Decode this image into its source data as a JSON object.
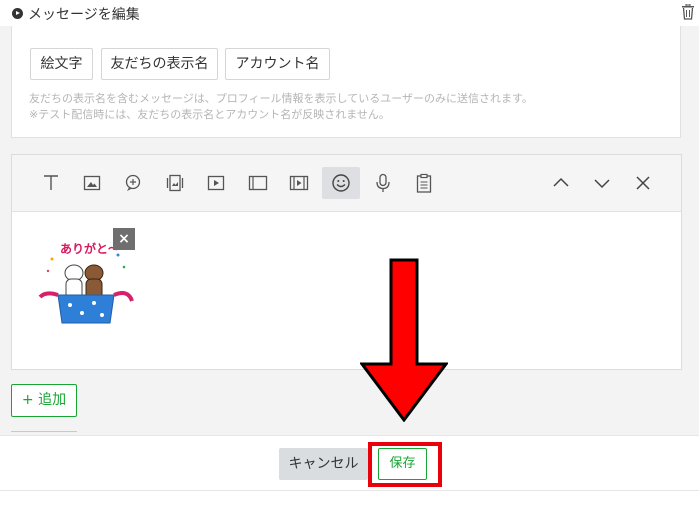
{
  "header": {
    "title": "メッセージを編集",
    "play_icon": "play-circle-icon",
    "delete_icon": "trash-icon"
  },
  "variables": {
    "chips": [
      "絵文字",
      "友だちの表示名",
      "アカウント名"
    ],
    "note_line1": "友だちの表示名を含むメッセージは、プロフィール情報を表示しているユーザーのみに送信されます。",
    "note_line2": "※テスト配信時には、友だちの表示名とアカウント名が反映されません。"
  },
  "editor": {
    "toolbar_icons": [
      "text-icon",
      "image-icon",
      "chat-bubble-icon",
      "card-icon",
      "video-icon",
      "rich-message-icon",
      "rich-video-icon",
      "sticker-icon",
      "mic-icon",
      "clipboard-icon"
    ],
    "active_tool": "sticker-icon",
    "nav_icons": [
      "chevron-up-icon",
      "chevron-down-icon",
      "close-icon"
    ],
    "sticker_text": "ありがと〜",
    "remove_sticker_label": "×"
  },
  "add_button": {
    "label": "+ 追加"
  },
  "footer": {
    "cancel_label": "キャンセル",
    "save_label": "保存"
  },
  "colors": {
    "accent_green": "#19a534",
    "highlight_red": "#e8000b",
    "arrow_red": "#ff0000"
  }
}
